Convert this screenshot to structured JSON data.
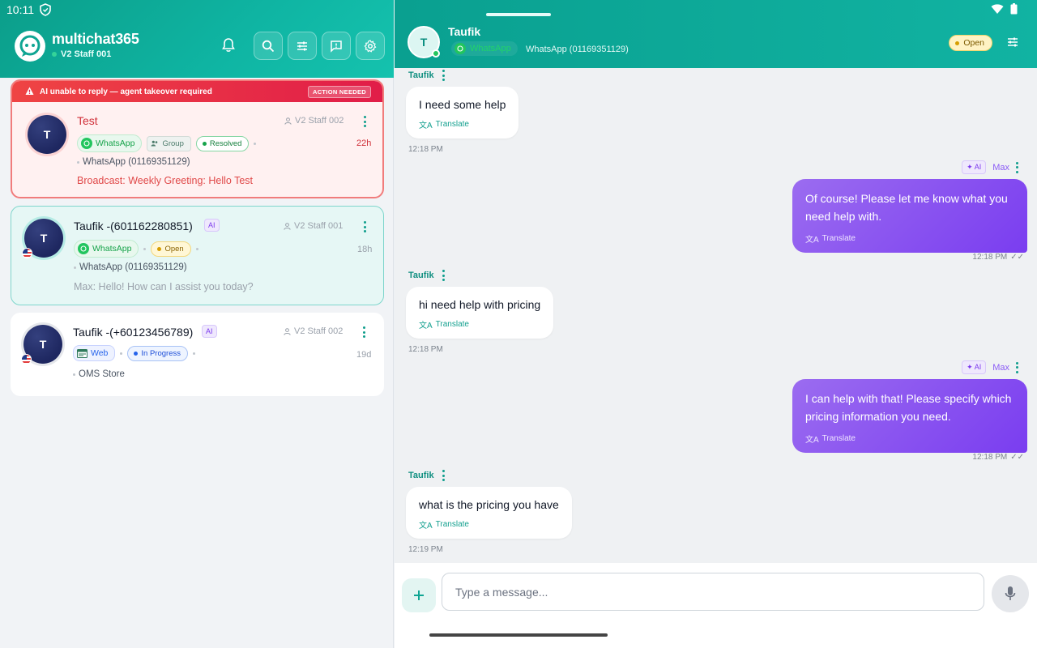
{
  "status": {
    "time": "10:11"
  },
  "app": {
    "brand": "multichat365",
    "staff": "V2 Staff 001"
  },
  "conversations": [
    {
      "alert": "AI unable to reply — agent takeover required",
      "alert_badge": "ACTION NEEDED",
      "avatar": "T",
      "name": "Test",
      "staff": "V2 Staff 002",
      "channel": "WhatsApp",
      "group": "Group",
      "status": "Resolved",
      "time": "22h",
      "meta": "WhatsApp (01169351129)",
      "preview": "Broadcast: Weekly Greeting: Hello Test"
    },
    {
      "avatar": "T",
      "name": "Taufik -(601162280851)",
      "ai": "AI",
      "staff": "V2 Staff 001",
      "channel": "WhatsApp",
      "status": "Open",
      "time": "18h",
      "meta": "WhatsApp (01169351129)",
      "preview": "Max: Hello! How can I assist you today?"
    },
    {
      "avatar": "T",
      "name": "Taufik -(+60123456789)",
      "ai": "AI",
      "staff": "V2 Staff 002",
      "channel": "Web",
      "status": "In Progress",
      "time": "19d",
      "meta": "OMS Store"
    }
  ],
  "chat": {
    "avatar": "T",
    "name": "Taufik",
    "channel": "WhatsApp",
    "number": "WhatsApp (01169351129)",
    "status": "Open",
    "translate_label": "Translate",
    "messages": [
      {
        "dir": "in",
        "sender": "Taufik",
        "text": "I need some help",
        "time": "12:18 PM"
      },
      {
        "dir": "out",
        "sender": "Max",
        "ai": "AI",
        "text": "Of course! Please let me know what you need help with.",
        "time": "12:18 PM"
      },
      {
        "dir": "in",
        "sender": "Taufik",
        "text": "hi need help with pricing",
        "time": "12:18 PM"
      },
      {
        "dir": "out",
        "sender": "Max",
        "ai": "AI",
        "text": "I can help with that! Please specify which pricing information you need.",
        "time": "12:18 PM"
      },
      {
        "dir": "in",
        "sender": "Taufik",
        "text": "what is the pricing you have",
        "time": "12:19 PM"
      }
    ]
  },
  "composer": {
    "placeholder": "Type a message..."
  },
  "colors": {
    "primary": "#0fb5a3",
    "ai": "#7c3aed",
    "alert": "#ef4444"
  }
}
